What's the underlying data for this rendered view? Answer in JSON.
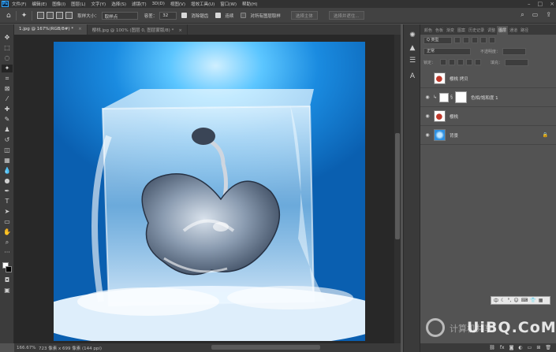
{
  "app": {
    "logo": "Ps"
  },
  "menu": [
    "文件(F)",
    "编辑(E)",
    "图像(I)",
    "图层(L)",
    "文字(Y)",
    "选择(S)",
    "滤镜(T)",
    "3D(D)",
    "视图(V)",
    "增效工具(U)",
    "窗口(W)",
    "帮助(H)"
  ],
  "options": {
    "sample_size_label": "取样大小：",
    "sample_size_value": "取样点",
    "tolerance_label": "容差：",
    "tolerance_value": "32",
    "antialias_label": "消除锯齿",
    "contiguous_label": "连续",
    "all_layers_label": "对所有图层取样",
    "select_subject_label": "选择主体",
    "select_mask_label": "选择并遮住..."
  },
  "tabs": [
    {
      "label": "1.jpg @ 167%(RGB/8#) *",
      "close": "×",
      "active": true
    },
    {
      "label": "樱桃.jpg @ 100% (图层 0, 图层蒙版/8) *",
      "close": "×",
      "active": false
    }
  ],
  "status": {
    "zoom": "166.67%",
    "doc_size": "723 像素 x 699 像素 (144 ppi)"
  },
  "panel": {
    "tabs": [
      "颜色",
      "色板",
      "渐变",
      "图案",
      "历史记录",
      "调整",
      "图层",
      "通道",
      "路径"
    ],
    "active_tab": "图层",
    "filter_label": "Q 类型",
    "blend_mode": "正常",
    "opacity_label": "不透明度：",
    "lock_label": "锁定：",
    "fill_label": "填充："
  },
  "layers": [
    {
      "name": "樱桃 拷贝",
      "visible": false,
      "thumb": "apple",
      "active": false
    },
    {
      "name": "色相/饱和度 1",
      "visible": true,
      "thumb": "adjust",
      "active": false
    },
    {
      "name": "樱桃",
      "visible": true,
      "thumb": "apple",
      "active": false
    },
    {
      "name": "背景",
      "visible": true,
      "thumb": "bg",
      "active": false,
      "locked": true
    }
  ],
  "icons": {
    "eye": "eye-icon",
    "lock": "lock-icon"
  },
  "colors": {
    "accent": "#31a8ff",
    "chrome": "#323232",
    "panel": "#535353"
  },
  "watermark": {
    "text": "UiBQ.CoM",
    "cn": "计算机共享"
  }
}
